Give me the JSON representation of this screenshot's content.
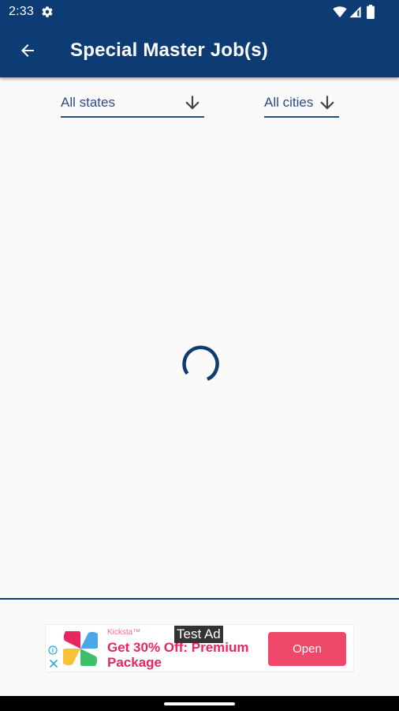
{
  "status_bar": {
    "time": "2:33",
    "icons": [
      "gear-icon",
      "wifi-icon",
      "signal-icon",
      "battery-icon"
    ]
  },
  "app_bar": {
    "title": "Special Master Job(s)",
    "back_icon": "arrow-left-icon",
    "background": "#0d3b73"
  },
  "filters": {
    "state": {
      "value": "All states",
      "icon": "arrow-down-icon"
    },
    "city": {
      "value": "All cities",
      "icon": "arrow-down-icon"
    }
  },
  "content": {
    "loading": true,
    "spinner_color": "#0d3b73"
  },
  "ad": {
    "brand": "Kicksta™",
    "headline": "Get 30% Off: Premium Package",
    "test_label": "Test Ad",
    "cta": "Open",
    "cta_color": "#ef4868",
    "icons": [
      "ad-info-icon",
      "ad-close-icon",
      "pinwheel-logo-icon"
    ]
  }
}
